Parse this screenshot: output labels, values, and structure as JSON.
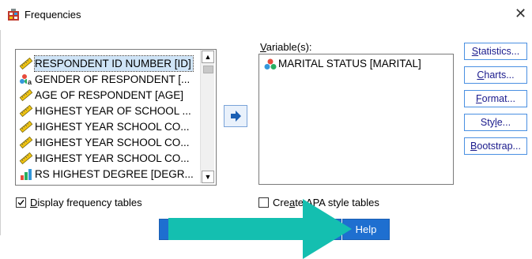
{
  "window": {
    "title": "Frequencies",
    "close_glyph": "✕"
  },
  "source_list": {
    "items": [
      {
        "label": "RESPONDENT ID NUMBER [ID]",
        "icon": "scale-ruler-icon",
        "selected": true
      },
      {
        "label": "GENDER OF RESPONDENT [...",
        "icon": "nominal-text-icon",
        "selected": false
      },
      {
        "label": "AGE OF RESPONDENT [AGE]",
        "icon": "scale-ruler-icon",
        "selected": false
      },
      {
        "label": "HIGHEST YEAR OF SCHOOL ...",
        "icon": "scale-ruler-icon",
        "selected": false
      },
      {
        "label": "HIGHEST YEAR SCHOOL CO...",
        "icon": "scale-ruler-icon",
        "selected": false
      },
      {
        "label": "HIGHEST YEAR SCHOOL CO...",
        "icon": "scale-ruler-icon",
        "selected": false
      },
      {
        "label": "HIGHEST YEAR SCHOOL CO...",
        "icon": "scale-ruler-icon",
        "selected": false
      },
      {
        "label": "RS HIGHEST DEGREE [DEGR...",
        "icon": "ordinal-bars-icon",
        "selected": false
      }
    ]
  },
  "variables": {
    "label_underlined": "V",
    "label_rest": "ariable(s):",
    "items": [
      {
        "label": "MARITAL STATUS [MARITAL]",
        "icon": "nominal-circles-icon"
      }
    ]
  },
  "side_buttons": [
    {
      "u": "S",
      "rest": "tatistics..."
    },
    {
      "u": "C",
      "rest": "harts..."
    },
    {
      "u": "F",
      "rest": "ormat..."
    },
    {
      "pre": "Sty",
      "u": "l",
      "rest": "e..."
    },
    {
      "u": "B",
      "rest": "ootstrap..."
    }
  ],
  "checkboxes": {
    "display_freq": {
      "u": "D",
      "rest": "isplay frequency tables",
      "checked": true
    },
    "apa": {
      "pre": "Cre",
      "u": "a",
      "rest": "te APA style tables",
      "checked": false
    }
  },
  "bottom_buttons": {
    "help": "Help"
  },
  "colors": {
    "primary_button": "#1e6fd0",
    "overlay_arrow": "#14bfb0",
    "selection": "#cfe4f7"
  }
}
